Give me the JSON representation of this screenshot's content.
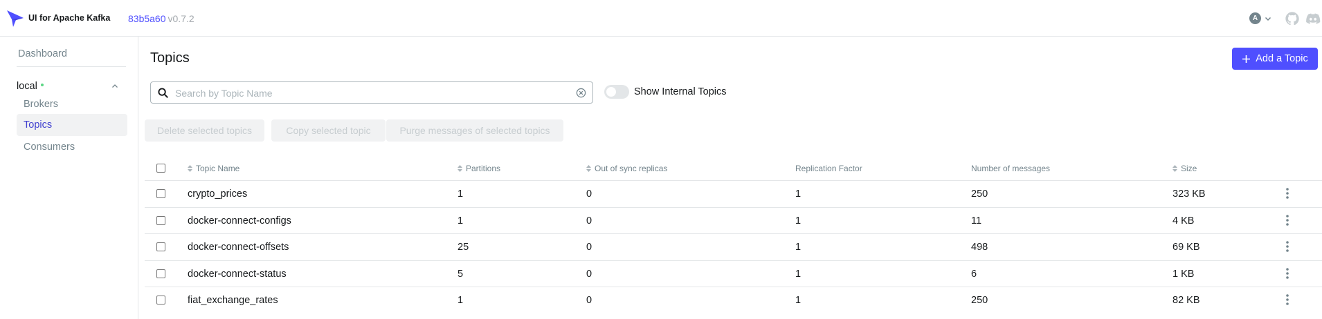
{
  "navbar": {
    "app_title": "UI for Apache Kafka",
    "version_hash": "83b5a60",
    "version": "v0.7.2",
    "avatar_letter": "A"
  },
  "sidebar": {
    "dashboard": "Dashboard",
    "cluster": "local",
    "items": [
      {
        "label": "Brokers",
        "active": false
      },
      {
        "label": "Topics",
        "active": true
      },
      {
        "label": "Consumers",
        "active": false
      }
    ]
  },
  "main": {
    "title": "Topics",
    "add_button": "Add a Topic",
    "search_placeholder": "Search by Topic Name",
    "toggle_label": "Show Internal Topics",
    "bulk_actions": [
      "Delete selected topics",
      "Copy selected topic",
      "Purge messages of selected topics"
    ]
  },
  "table": {
    "columns": [
      "Topic Name",
      "Partitions",
      "Out of sync replicas",
      "Replication Factor",
      "Number of messages",
      "Size"
    ],
    "rows": [
      {
        "name": "crypto_prices",
        "partitions": "1",
        "out_of_sync": "0",
        "replication": "1",
        "messages": "250",
        "size": "323 KB"
      },
      {
        "name": "docker-connect-configs",
        "partitions": "1",
        "out_of_sync": "0",
        "replication": "1",
        "messages": "11",
        "size": "4 KB"
      },
      {
        "name": "docker-connect-offsets",
        "partitions": "25",
        "out_of_sync": "0",
        "replication": "1",
        "messages": "498",
        "size": "69 KB"
      },
      {
        "name": "docker-connect-status",
        "partitions": "5",
        "out_of_sync": "0",
        "replication": "1",
        "messages": "6",
        "size": "1 KB"
      },
      {
        "name": "fiat_exchange_rates",
        "partitions": "1",
        "out_of_sync": "0",
        "replication": "1",
        "messages": "250",
        "size": "82 KB"
      }
    ]
  },
  "colors": {
    "accent": "#4f4fff",
    "cluster_status": "#5cd685",
    "muted_text": "#73848c"
  }
}
